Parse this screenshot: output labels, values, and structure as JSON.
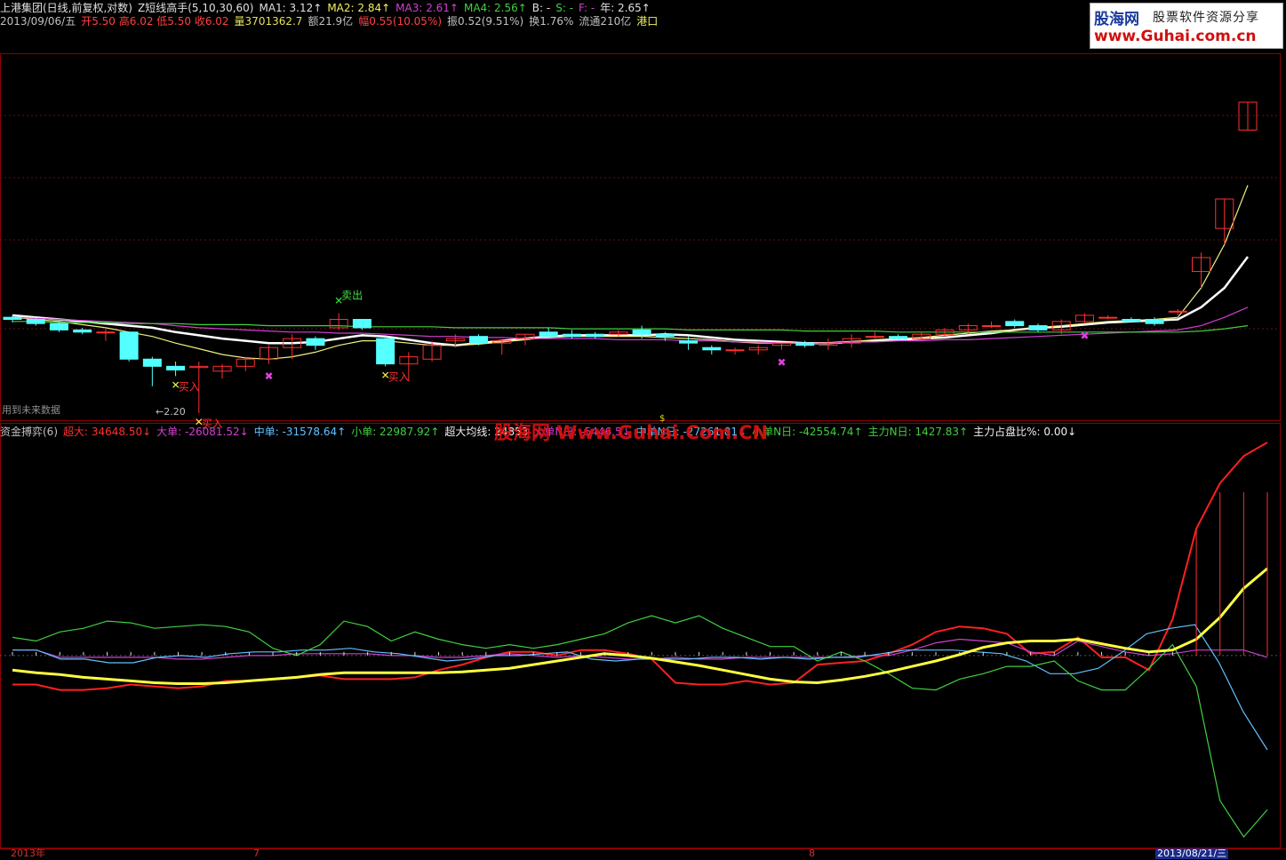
{
  "header": {
    "line1": [
      {
        "text": "上港集团(日线,前复权,对数)",
        "color": "#e0e0e0"
      },
      {
        "text": "Z短线高手(5,10,30,60)",
        "color": "#e0e0e0"
      },
      {
        "text": "MA1: 3.12↑",
        "color": "#e0e0e0"
      },
      {
        "text": "MA2: 2.84↑",
        "color": "#f0f060"
      },
      {
        "text": "MA3: 2.61↑",
        "color": "#d040d0"
      },
      {
        "text": "MA4: 2.56↑",
        "color": "#40d040"
      },
      {
        "text": "B: -",
        "color": "#e0e0e0"
      },
      {
        "text": "S: -",
        "color": "#40d040"
      },
      {
        "text": "F: -",
        "color": "#d040d0"
      },
      {
        "text": "年: 2.65↑",
        "color": "#e0e0e0"
      }
    ],
    "line2": [
      {
        "text": "2013/09/06/五",
        "color": "#c0c0c0"
      },
      {
        "text": "开5.50 高6.02 低5.50 收6.02",
        "color": "#ff4040"
      },
      {
        "text": "量3701362.7",
        "color": "#e0e060"
      },
      {
        "text": "额21.9亿",
        "color": "#c0c0c0"
      },
      {
        "text": "幅0.55(10.05%)",
        "color": "#ff4040"
      },
      {
        "text": "振0.52(9.51%)",
        "color": "#c0c0c0"
      },
      {
        "text": "换1.76%",
        "color": "#c0c0c0"
      },
      {
        "text": "流通210亿",
        "color": "#c0c0c0"
      },
      {
        "text": "港口",
        "color": "#f0f060"
      }
    ]
  },
  "indicator": {
    "items": [
      {
        "text": "资金搏弈(6)",
        "color": "#c0c0c0"
      },
      {
        "text": "超大: 34648.50↓",
        "color": "#ff3030"
      },
      {
        "text": "大单: -26081.52↓",
        "color": "#d040d0"
      },
      {
        "text": "中单: -31578.64↑",
        "color": "#60c0ff"
      },
      {
        "text": "小单: 22987.92↑",
        "color": "#40d040"
      },
      {
        "text": "超大均线: 24853",
        "color": "#f0f0f0"
      },
      {
        "text": "大单N日: -5446.5↓",
        "color": "#d040d0"
      },
      {
        "text": "中单N日: -27261.81↓",
        "color": "#60c0ff"
      },
      {
        "text": "小单N日: -42554.74↑",
        "color": "#40d040"
      },
      {
        "text": "主力N日: 1427.83↑",
        "color": "#40d040"
      },
      {
        "text": "主力占盘比%: 0.00↓",
        "color": "#f0f0f0"
      }
    ]
  },
  "logo": {
    "brand": "股海网",
    "tagline": "股票软件资源分享",
    "url": "www.Guhai.com.cn"
  },
  "watermark": "股海网 Www.Guhai.Com.CN",
  "future_note": "用到未来数据",
  "low_label": "←2.20",
  "overlay_b": "$",
  "signals": {
    "buy": "买入",
    "sell": "卖出"
  },
  "axis": {
    "start": "2013年",
    "m7": "7",
    "m8": "8",
    "cursor": "2013/08/21/三"
  },
  "colors": {
    "up": "#ff3030",
    "down": "#54ffff",
    "bg": "#000000",
    "border": "#8b0000"
  },
  "chart_data": {
    "type": "candlestick",
    "candles": [
      [
        3.0,
        3.02,
        2.95,
        2.98
      ],
      [
        2.98,
        3.0,
        2.92,
        2.94
      ],
      [
        2.94,
        2.96,
        2.86,
        2.88
      ],
      [
        2.88,
        2.9,
        2.84,
        2.86
      ],
      [
        2.86,
        2.9,
        2.78,
        2.86
      ],
      [
        2.86,
        2.86,
        2.6,
        2.62
      ],
      [
        2.62,
        2.64,
        2.4,
        2.56
      ],
      [
        2.56,
        2.6,
        2.48,
        2.53
      ],
      [
        2.55,
        2.6,
        2.2,
        2.56
      ],
      [
        2.52,
        2.58,
        2.46,
        2.56
      ],
      [
        2.56,
        2.64,
        2.52,
        2.62
      ],
      [
        2.62,
        2.74,
        2.58,
        2.72
      ],
      [
        2.72,
        2.84,
        2.62,
        2.8
      ],
      [
        2.8,
        2.82,
        2.7,
        2.74
      ],
      [
        2.9,
        3.04,
        2.88,
        2.98
      ],
      [
        2.98,
        2.98,
        2.88,
        2.9
      ],
      [
        2.8,
        2.82,
        2.56,
        2.58
      ],
      [
        2.58,
        2.68,
        2.44,
        2.64
      ],
      [
        2.62,
        2.78,
        2.6,
        2.74
      ],
      [
        2.78,
        2.84,
        2.72,
        2.8
      ],
      [
        2.82,
        2.84,
        2.74,
        2.76
      ],
      [
        2.76,
        2.78,
        2.66,
        2.78
      ],
      [
        2.8,
        2.84,
        2.74,
        2.84
      ],
      [
        2.86,
        2.9,
        2.82,
        2.82
      ],
      [
        2.84,
        2.88,
        2.8,
        2.82
      ],
      [
        2.84,
        2.86,
        2.8,
        2.82
      ],
      [
        2.84,
        2.88,
        2.82,
        2.86
      ],
      [
        2.88,
        2.92,
        2.8,
        2.84
      ],
      [
        2.84,
        2.86,
        2.78,
        2.82
      ],
      [
        2.78,
        2.82,
        2.7,
        2.76
      ],
      [
        2.72,
        2.74,
        2.66,
        2.7
      ],
      [
        2.7,
        2.72,
        2.66,
        2.7
      ],
      [
        2.7,
        2.74,
        2.66,
        2.72
      ],
      [
        2.74,
        2.76,
        2.7,
        2.76
      ],
      [
        2.76,
        2.78,
        2.72,
        2.74
      ],
      [
        2.74,
        2.8,
        2.7,
        2.76
      ],
      [
        2.76,
        2.84,
        2.72,
        2.8
      ],
      [
        2.82,
        2.86,
        2.8,
        2.82
      ],
      [
        2.82,
        2.84,
        2.78,
        2.8
      ],
      [
        2.8,
        2.86,
        2.78,
        2.84
      ],
      [
        2.84,
        2.9,
        2.82,
        2.88
      ],
      [
        2.88,
        2.94,
        2.84,
        2.92
      ],
      [
        2.92,
        2.96,
        2.9,
        2.92
      ],
      [
        2.96,
        2.98,
        2.9,
        2.92
      ],
      [
        2.92,
        2.94,
        2.86,
        2.88
      ],
      [
        2.88,
        2.98,
        2.84,
        2.96
      ],
      [
        2.96,
        3.04,
        2.94,
        3.02
      ],
      [
        3.0,
        3.02,
        2.98,
        3.0
      ],
      [
        2.98,
        3.0,
        2.96,
        2.96
      ],
      [
        2.98,
        3.0,
        2.92,
        2.94
      ],
      [
        3.06,
        3.08,
        3.02,
        3.06
      ],
      [
        3.48,
        3.7,
        3.3,
        3.64
      ],
      [
        4.0,
        4.4,
        3.8,
        4.4
      ],
      [
        5.5,
        6.02,
        5.5,
        6.02
      ]
    ],
    "ma_lines": [
      {
        "name": "MA1",
        "color": "#ffffff",
        "values": [
          3.02,
          3.0,
          2.98,
          2.96,
          2.94,
          2.92,
          2.9,
          2.86,
          2.83,
          2.8,
          2.78,
          2.76,
          2.76,
          2.77,
          2.8,
          2.83,
          2.82,
          2.79,
          2.76,
          2.74,
          2.76,
          2.78,
          2.8,
          2.82,
          2.83,
          2.83,
          2.83,
          2.83,
          2.84,
          2.83,
          2.81,
          2.79,
          2.78,
          2.77,
          2.76,
          2.76,
          2.77,
          2.78,
          2.79,
          2.8,
          2.81,
          2.83,
          2.85,
          2.88,
          2.9,
          2.91,
          2.93,
          2.95,
          2.96,
          2.97,
          2.98,
          3.1,
          3.3,
          3.65
        ]
      },
      {
        "name": "MA2",
        "color": "#f0f080",
        "values": [
          3.0,
          2.98,
          2.96,
          2.93,
          2.9,
          2.86,
          2.82,
          2.76,
          2.71,
          2.66,
          2.63,
          2.62,
          2.64,
          2.68,
          2.74,
          2.78,
          2.78,
          2.76,
          2.74,
          2.74,
          2.75,
          2.77,
          2.79,
          2.81,
          2.82,
          2.82,
          2.82,
          2.82,
          2.81,
          2.8,
          2.79,
          2.77,
          2.76,
          2.76,
          2.76,
          2.76,
          2.77,
          2.79,
          2.8,
          2.81,
          2.83,
          2.85,
          2.87,
          2.88,
          2.9,
          2.92,
          2.94,
          2.96,
          2.97,
          2.98,
          3.0,
          3.3,
          3.8,
          4.6
        ]
      },
      {
        "name": "MA3",
        "color": "#d040d0",
        "values": [
          3.0,
          2.99,
          2.98,
          2.97,
          2.96,
          2.95,
          2.94,
          2.92,
          2.9,
          2.89,
          2.88,
          2.87,
          2.86,
          2.86,
          2.85,
          2.85,
          2.84,
          2.83,
          2.82,
          2.82,
          2.81,
          2.81,
          2.8,
          2.8,
          2.8,
          2.8,
          2.79,
          2.79,
          2.79,
          2.78,
          2.78,
          2.77,
          2.77,
          2.76,
          2.76,
          2.76,
          2.77,
          2.77,
          2.78,
          2.78,
          2.79,
          2.79,
          2.8,
          2.81,
          2.82,
          2.83,
          2.84,
          2.85,
          2.86,
          2.87,
          2.88,
          2.92,
          3.0,
          3.1
        ]
      },
      {
        "name": "MA4",
        "color": "#40d040",
        "values": [
          2.96,
          2.96,
          2.95,
          2.95,
          2.95,
          2.94,
          2.94,
          2.94,
          2.93,
          2.93,
          2.93,
          2.92,
          2.92,
          2.92,
          2.92,
          2.91,
          2.91,
          2.91,
          2.91,
          2.9,
          2.9,
          2.9,
          2.9,
          2.9,
          2.89,
          2.89,
          2.89,
          2.89,
          2.89,
          2.88,
          2.88,
          2.88,
          2.88,
          2.88,
          2.87,
          2.87,
          2.87,
          2.87,
          2.86,
          2.86,
          2.86,
          2.86,
          2.86,
          2.86,
          2.86,
          2.86,
          2.86,
          2.86,
          2.86,
          2.86,
          2.86,
          2.87,
          2.89,
          2.92
        ]
      }
    ],
    "indicator_series": [
      {
        "name": "超大",
        "color": "#ff2020",
        "values": [
          -3.2,
          -3.2,
          -3.8,
          -3.8,
          -3.6,
          -3.2,
          -3.4,
          -3.6,
          -3.4,
          -2.8,
          -2.8,
          -2.6,
          -2.4,
          -2.2,
          -2.6,
          -2.6,
          -2.6,
          -2.4,
          -1.6,
          -1.0,
          -0.2,
          0.4,
          0.4,
          0.0,
          0.6,
          0.6,
          0.2,
          -0.4,
          -3.0,
          -3.2,
          -3.2,
          -2.8,
          -3.2,
          -3.0,
          -1.0,
          -0.8,
          -0.6,
          0.2,
          1.2,
          2.6,
          3.2,
          3.0,
          2.4,
          0.2,
          0.4,
          2.0,
          -0.2,
          -0.2,
          -1.6,
          4.0,
          14.0,
          19.0,
          22.0,
          23.5
        ]
      },
      {
        "name": "大单",
        "color": "#d040d0",
        "values": [
          0.6,
          0.6,
          -0.2,
          -0.2,
          -0.2,
          -0.2,
          -0.2,
          -0.4,
          -0.4,
          -0.2,
          0.0,
          0.0,
          0.2,
          0.2,
          0.2,
          0.2,
          0.0,
          0.0,
          -0.2,
          -0.2,
          0.0,
          0.2,
          0.0,
          -0.2,
          0.0,
          -0.2,
          -0.4,
          -0.4,
          -0.2,
          -0.4,
          -0.4,
          -0.2,
          -0.2,
          -0.2,
          -0.2,
          -0.2,
          0.0,
          0.0,
          0.6,
          1.4,
          1.8,
          1.6,
          1.4,
          0.4,
          0.0,
          1.6,
          1.0,
          0.4,
          0.0,
          0.2,
          0.6,
          0.6,
          0.6,
          -0.2
        ]
      },
      {
        "name": "中单",
        "color": "#60c0ff",
        "values": [
          0.6,
          0.6,
          -0.4,
          -0.4,
          -0.8,
          -0.8,
          -0.2,
          0.0,
          -0.2,
          0.2,
          0.4,
          0.4,
          0.6,
          0.6,
          0.8,
          0.4,
          0.2,
          -0.2,
          -0.6,
          -0.4,
          0.0,
          0.0,
          0.2,
          0.4,
          -0.4,
          -0.6,
          -0.4,
          -0.4,
          -0.4,
          -0.2,
          -0.2,
          -0.4,
          -0.2,
          -0.4,
          -0.2,
          -0.2,
          0.2,
          0.6,
          0.6,
          0.6,
          0.4,
          0.2,
          -0.6,
          -2.0,
          -2.0,
          -1.4,
          0.4,
          2.4,
          3.0,
          3.4,
          -0.8,
          -6.2,
          -10.4
        ]
      },
      {
        "name": "小单",
        "color": "#40d040",
        "values": [
          2.0,
          1.6,
          2.6,
          3.0,
          3.8,
          3.6,
          3.0,
          3.2,
          3.4,
          3.2,
          2.6,
          0.8,
          0.0,
          1.2,
          3.8,
          3.2,
          1.6,
          2.6,
          1.8,
          1.2,
          0.8,
          1.2,
          0.8,
          1.2,
          1.8,
          2.4,
          3.6,
          4.4,
          3.6,
          4.4,
          3.0,
          2.0,
          1.0,
          1.0,
          -0.6,
          0.4,
          -0.6,
          -2.0,
          -3.6,
          -3.8,
          -2.6,
          -2.0,
          -1.2,
          -1.2,
          -0.6,
          -2.8,
          -3.8,
          -3.8,
          -1.4,
          1.2,
          -3.4,
          -16.0,
          -20.0,
          -17.0
        ]
      },
      {
        "name": "超大均线",
        "color": "#ffff40",
        "values": [
          -1.6,
          -1.9,
          -2.1,
          -2.4,
          -2.6,
          -2.8,
          -3.0,
          -3.1,
          -3.1,
          -3.0,
          -2.8,
          -2.6,
          -2.4,
          -2.1,
          -1.9,
          -1.9,
          -1.9,
          -1.9,
          -1.9,
          -1.8,
          -1.6,
          -1.4,
          -1.0,
          -0.6,
          -0.2,
          0.2,
          0.0,
          -0.3,
          -0.7,
          -1.1,
          -1.6,
          -2.1,
          -2.6,
          -2.9,
          -3.0,
          -2.7,
          -2.3,
          -1.8,
          -1.2,
          -0.6,
          0.1,
          0.9,
          1.4,
          1.6,
          1.6,
          1.8,
          1.3,
          0.8,
          0.4,
          0.6,
          1.8,
          4.2,
          7.4,
          9.6
        ]
      }
    ]
  }
}
